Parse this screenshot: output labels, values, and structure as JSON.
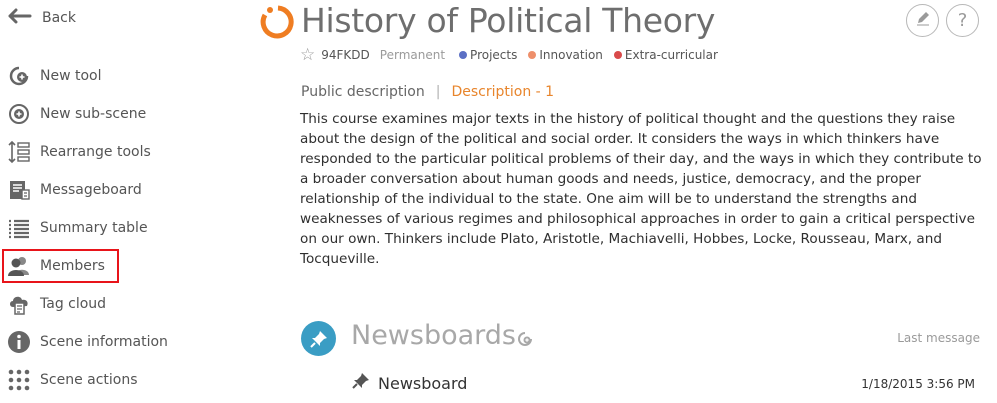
{
  "sidebar": {
    "back_label": "Back",
    "items": [
      {
        "label": "New tool",
        "icon": "add-tool-icon"
      },
      {
        "label": "New sub-scene",
        "icon": "add-subscene-icon"
      },
      {
        "label": "Rearrange tools",
        "icon": "rearrange-icon"
      },
      {
        "label": "Messageboard",
        "icon": "messageboard-icon"
      },
      {
        "label": "Summary table",
        "icon": "summary-table-icon"
      },
      {
        "label": "Members",
        "icon": "members-icon"
      },
      {
        "label": "Tag cloud",
        "icon": "tag-cloud-icon"
      },
      {
        "label": "Scene information",
        "icon": "info-icon"
      },
      {
        "label": "Scene actions",
        "icon": "actions-icon"
      }
    ]
  },
  "header": {
    "title": "History of Political Theory",
    "code": "94FKDD",
    "status": "Permanent",
    "tags": [
      {
        "label": "Projects",
        "color": "#5b6fc4"
      },
      {
        "label": "Innovation",
        "color": "#ee8f6b"
      },
      {
        "label": "Extra-curricular",
        "color": "#d94a4a"
      }
    ],
    "accent_color": "#ef7d22"
  },
  "description": {
    "tab_public": "Public description",
    "tab_separator": "|",
    "tab_active": "Description - 1",
    "text": "This course examines major texts in the history of political thought and the questions they raise about the design of the political and social order. It considers the ways in which thinkers have responded to the particular political problems of their day, and the ways in which they contribute to a broader conversation about human goods and needs, justice, democracy, and the proper relationship of the individual to the state. One aim will be to understand the strengths and weaknesses of various regimes and philosophical approaches in order to gain a critical perspective on our own. Thinkers include Plato, Aristotle, Machiavelli, Hobbes, Locke, Rousseau, Marx, and Tocqueville."
  },
  "newsboards": {
    "title": "Newsboards",
    "column_label": "Last message",
    "items": [
      {
        "name": "Newsboard",
        "last_message": "1/18/2015 3:56 PM"
      }
    ]
  }
}
